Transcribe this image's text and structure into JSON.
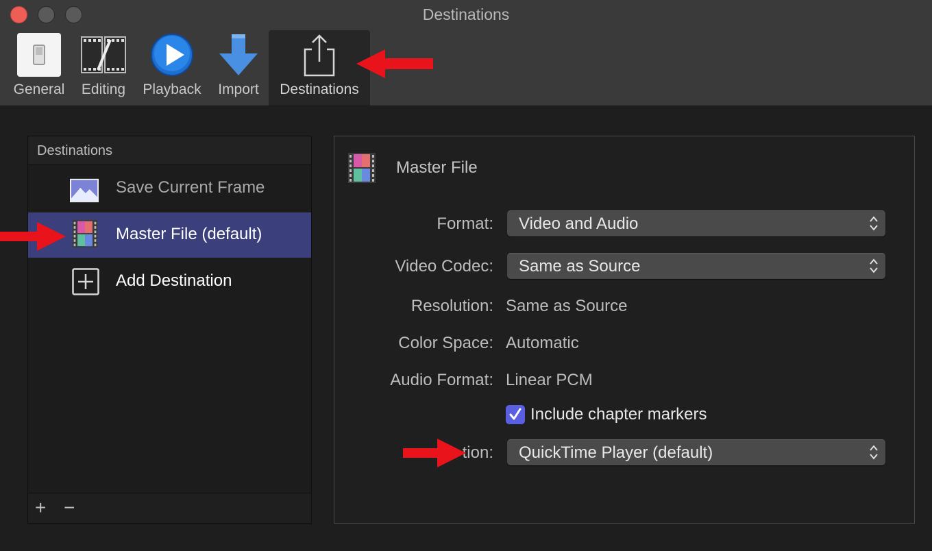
{
  "window": {
    "title": "Destinations"
  },
  "toolbar": {
    "items": [
      {
        "label": "General",
        "icon": "light-switch-icon"
      },
      {
        "label": "Editing",
        "icon": "film-strip-icon"
      },
      {
        "label": "Playback",
        "icon": "play-circle-icon"
      },
      {
        "label": "Import",
        "icon": "down-arrow-icon"
      },
      {
        "label": "Destinations",
        "icon": "share-icon",
        "selected": true
      }
    ]
  },
  "sidebar": {
    "header": "Destinations",
    "items": [
      {
        "label": "Save Current Frame",
        "icon": "landscape-image-icon"
      },
      {
        "label": "Master File (default)",
        "icon": "film-frame-icon",
        "selected": true
      },
      {
        "label": "Add Destination",
        "icon": "plus-square-icon"
      }
    ],
    "footer": {
      "add": "+",
      "remove": "−"
    }
  },
  "detail": {
    "title": "Master File",
    "format": {
      "label": "Format:",
      "value": "Video and Audio"
    },
    "video_codec": {
      "label": "Video Codec:",
      "value": "Same as Source"
    },
    "resolution": {
      "label": "Resolution:",
      "value": "Same as Source"
    },
    "color_space": {
      "label": "Color Space:",
      "value": "Automatic"
    },
    "audio_format": {
      "label": "Audio Format:",
      "value": "Linear PCM"
    },
    "chapter_markers": {
      "label": "Include chapter markers",
      "checked": true
    },
    "open_with": {
      "label": "tion:",
      "value": "QuickTime Player (default)"
    }
  },
  "colors": {
    "accent": "#3b3f7c",
    "checkbox": "#5a5ee0",
    "annotation": "#e8131b"
  }
}
